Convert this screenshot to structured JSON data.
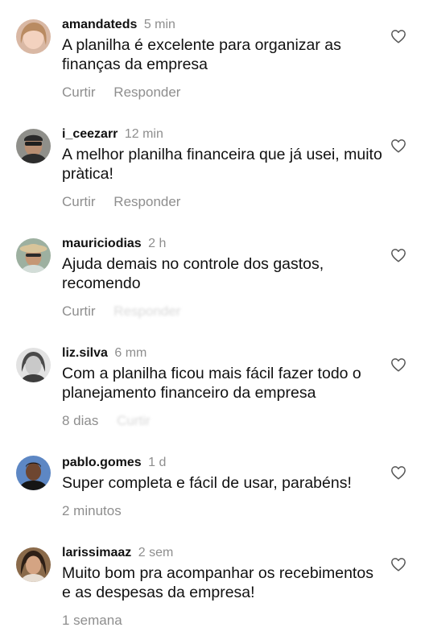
{
  "comments": [
    {
      "username": "amandateds",
      "time": "5 min",
      "text": "A planilha é excelente para organizar as finanças da empresa",
      "like_label": "Curtir",
      "reply_label": "Responder"
    },
    {
      "username": "i_ceezarr",
      "time": "12 min",
      "text": "A melhor planilha financeira que já usei, muito pràtica!",
      "like_label": "Curtir",
      "reply_label": "Responder"
    },
    {
      "username": "mauriciodias",
      "time": "2 h",
      "text": "Ajuda demais no controle dos gastos, recomendo",
      "like_label": "Curtir",
      "reply_label": "Responder"
    },
    {
      "username": "liz.silva",
      "time": "6 mm",
      "text": "Com a planilha ficou mais fácil fazer todo o planejamento financeiro da empresa",
      "footer": "8 dias",
      "reply_label": "Curtir"
    },
    {
      "username": "pablo.gomes",
      "time": "1 d",
      "text": "Super completa e fácil de usar, parabéns!",
      "footer": "2 minutos"
    },
    {
      "username": "larissimaaz",
      "time": "2 sem",
      "text": "Muito bom pra acompanhar os recebimentos e as despesas da empresa!",
      "footer": "1 semana"
    }
  ],
  "icons": {
    "like": "heart-outline-icon"
  },
  "colors": {
    "secondary_text": "#8e8e8e",
    "primary_text": "#111111",
    "background": "#ffffff"
  }
}
